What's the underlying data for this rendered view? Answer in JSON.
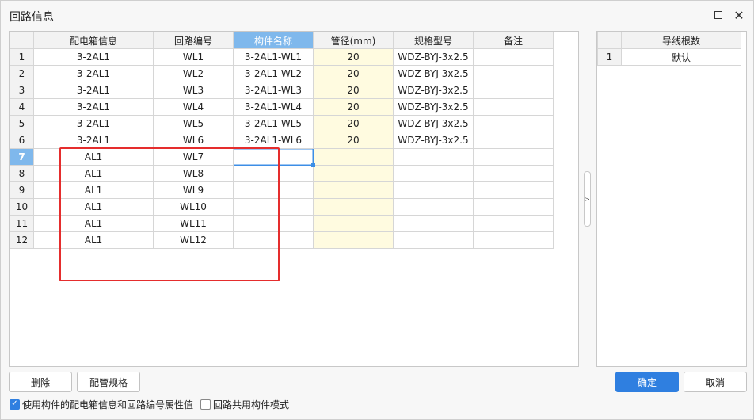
{
  "window": {
    "title": "回路信息",
    "maximize_glyph": "",
    "close_glyph": "✕"
  },
  "main_table": {
    "headers": [
      "配电箱信息",
      "回路编号",
      "构件名称",
      "管径(mm)",
      "规格型号",
      "备注"
    ],
    "active_header_index": 2,
    "current_row": 7,
    "rows": [
      {
        "num": "1",
        "box": "3-2AL1",
        "circuit": "WL1",
        "component": "3-2AL1-WL1",
        "pipe": "20",
        "spec": "WDZ-BYJ-3x2.5",
        "note": ""
      },
      {
        "num": "2",
        "box": "3-2AL1",
        "circuit": "WL2",
        "component": "3-2AL1-WL2",
        "pipe": "20",
        "spec": "WDZ-BYJ-3x2.5",
        "note": ""
      },
      {
        "num": "3",
        "box": "3-2AL1",
        "circuit": "WL3",
        "component": "3-2AL1-WL3",
        "pipe": "20",
        "spec": "WDZ-BYJ-3x2.5",
        "note": ""
      },
      {
        "num": "4",
        "box": "3-2AL1",
        "circuit": "WL4",
        "component": "3-2AL1-WL4",
        "pipe": "20",
        "spec": "WDZ-BYJ-3x2.5",
        "note": ""
      },
      {
        "num": "5",
        "box": "3-2AL1",
        "circuit": "WL5",
        "component": "3-2AL1-WL5",
        "pipe": "20",
        "spec": "WDZ-BYJ-3x2.5",
        "note": ""
      },
      {
        "num": "6",
        "box": "3-2AL1",
        "circuit": "WL6",
        "component": "3-2AL1-WL6",
        "pipe": "20",
        "spec": "WDZ-BYJ-3x2.5",
        "note": ""
      },
      {
        "num": "7",
        "box": "AL1",
        "circuit": "WL7",
        "component": "",
        "pipe": "",
        "spec": "",
        "note": ""
      },
      {
        "num": "8",
        "box": "AL1",
        "circuit": "WL8",
        "component": "",
        "pipe": "",
        "spec": "",
        "note": ""
      },
      {
        "num": "9",
        "box": "AL1",
        "circuit": "WL9",
        "component": "",
        "pipe": "",
        "spec": "",
        "note": ""
      },
      {
        "num": "10",
        "box": "AL1",
        "circuit": "WL10",
        "component": "",
        "pipe": "",
        "spec": "",
        "note": ""
      },
      {
        "num": "11",
        "box": "AL1",
        "circuit": "WL11",
        "component": "",
        "pipe": "",
        "spec": "",
        "note": ""
      },
      {
        "num": "12",
        "box": "AL1",
        "circuit": "WL12",
        "component": "",
        "pipe": "",
        "spec": "",
        "note": ""
      }
    ]
  },
  "side_table": {
    "header": "导线根数",
    "rows": [
      {
        "num": "1",
        "value": "默认"
      }
    ]
  },
  "splitter_glyph": ">",
  "buttons": {
    "delete": "删除",
    "pipe_spec": "配管规格",
    "ok": "确定",
    "cancel": "取消"
  },
  "options": {
    "use_props": {
      "label": "使用构件的配电箱信息和回路编号属性值",
      "checked": true
    },
    "shared_mode": {
      "label": "回路共用构件模式",
      "checked": false
    }
  },
  "colors": {
    "accent": "#2f7fe0",
    "header_active": "#7fb8ec",
    "pipe_column_bg": "#fffbe0",
    "annotation": "#e52d2d"
  }
}
